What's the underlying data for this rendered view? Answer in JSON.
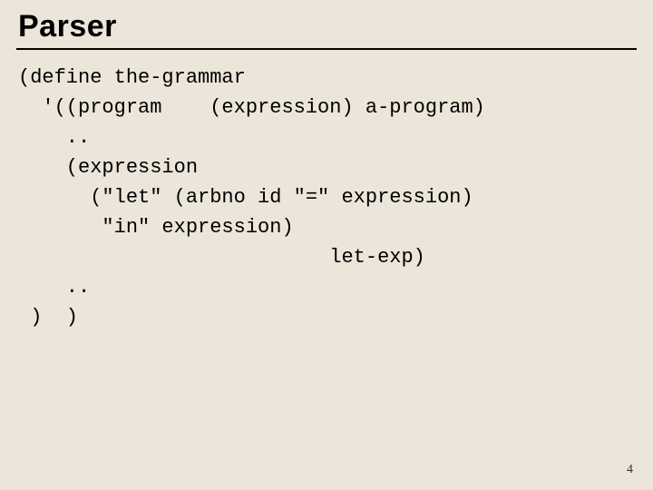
{
  "title": "Parser",
  "code": {
    "l1": "(define the-grammar",
    "l2": "  '((program    (expression) a-program)",
    "l3": "    ..",
    "l4": "    (expression",
    "l5": "      (\"let\" (arbno id \"=\" expression)",
    "l6": "       \"in\" expression)",
    "l7": "                          let-exp)",
    "l8": "    ..",
    "l9": " )  )"
  },
  "page_number": "4"
}
